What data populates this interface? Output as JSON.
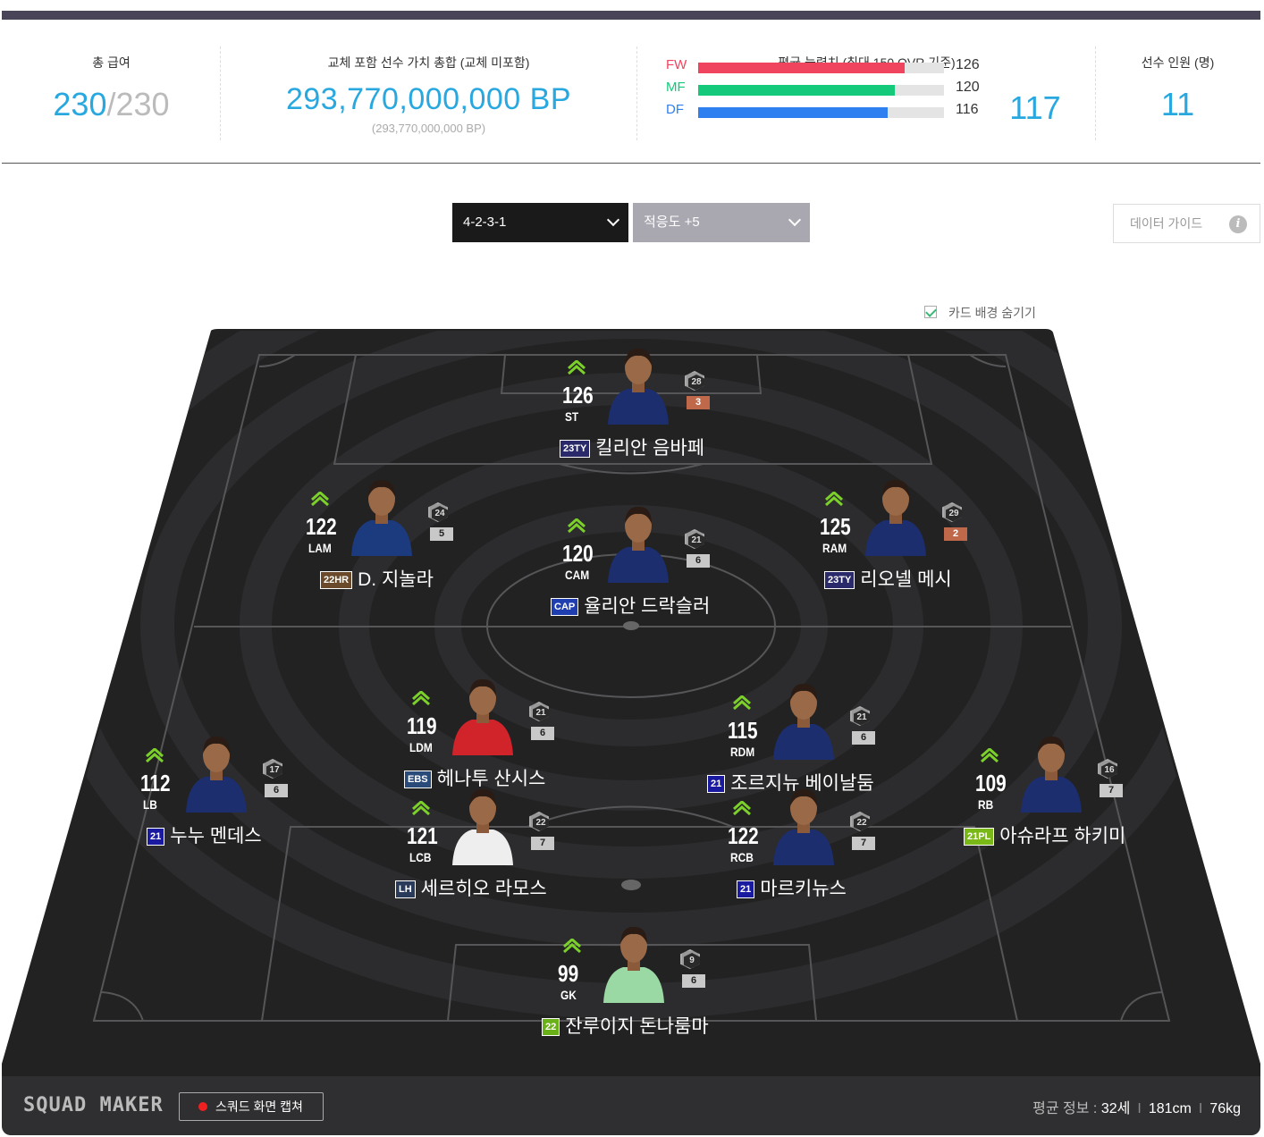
{
  "stats": {
    "salary_label": "총 급여",
    "salary_used": "230",
    "salary_sep": "/",
    "salary_max": "230",
    "bp_label": "교체 포함 선수 가치 총합 (교체 미포함)",
    "bp_value": "293,770,000,000 BP",
    "bp_sub": "(293,770,000,000 BP)",
    "ability_label": "평균 능력치 (최대 150 OVR 기준)",
    "abilities": [
      {
        "name": "FW",
        "value": "126",
        "color": "#f0445e",
        "fraction": 0.84
      },
      {
        "name": "MF",
        "value": "120",
        "color": "#14c97a",
        "fraction": 0.8
      },
      {
        "name": "DF",
        "value": "116",
        "color": "#2e7ff0",
        "fraction": 0.77
      }
    ],
    "ability_avg": "117",
    "count_label": "선수 인원 (명)",
    "count_value": "11"
  },
  "controls": {
    "formation": "4-2-3-1",
    "formation_bg": "#1a1a1a",
    "adaptability": "적응도 +5",
    "adaptability_bg": "#a9a7b0",
    "guide_label": "데이터 가이드",
    "guide_icon": "info-icon",
    "hide_bg_label": "카드 배경 숨기기"
  },
  "players": [
    {
      "id": "st",
      "ovr": "126",
      "pos": "ST",
      "name": "킬리안 음바페",
      "season": "23TY",
      "season_color": "#2a2a6a",
      "level": "28",
      "enh": "3",
      "enh_color": "#c0684a",
      "jersey": "#1c2e6e"
    },
    {
      "id": "lam",
      "ovr": "122",
      "pos": "LAM",
      "name": "D. 지놀라",
      "season": "22HR",
      "season_color": "#6a4a2a",
      "level": "24",
      "enh": "5",
      "enh_color": "#c8c8c8",
      "jersey": "#1c3a7e"
    },
    {
      "id": "cam",
      "ovr": "120",
      "pos": "CAM",
      "name": "율리안 드락슬러",
      "season": "CAP",
      "season_color": "#1f3fb0",
      "level": "21",
      "enh": "6",
      "enh_color": "#c8c8c8",
      "jersey": "#1c2e6e"
    },
    {
      "id": "ram",
      "ovr": "125",
      "pos": "RAM",
      "name": "리오넬 메시",
      "season": "23TY",
      "season_color": "#2a2a6a",
      "level": "29",
      "enh": "2",
      "enh_color": "#c0684a",
      "jersey": "#1c2e6e"
    },
    {
      "id": "ldm",
      "ovr": "119",
      "pos": "LDM",
      "name": "헤나투 산시스",
      "season": "EBS",
      "season_color": "#2a4a7a",
      "level": "21",
      "enh": "6",
      "enh_color": "#c8c8c8",
      "jersey": "#d0232a"
    },
    {
      "id": "rdm",
      "ovr": "115",
      "pos": "RDM",
      "name": "조르지뉴 베이날둠",
      "season": "21",
      "season_color": "#1a1aa0",
      "level": "21",
      "enh": "6",
      "enh_color": "#c8c8c8",
      "jersey": "#1c2e6e"
    },
    {
      "id": "lb",
      "ovr": "112",
      "pos": "LB",
      "name": "누누 멘데스",
      "season": "21",
      "season_color": "#1a1aa0",
      "level": "17",
      "enh": "6",
      "enh_color": "#c8c8c8",
      "jersey": "#1c2e6e"
    },
    {
      "id": "lcb",
      "ovr": "121",
      "pos": "LCB",
      "name": "세르히오 라모스",
      "season": "LH",
      "season_color": "#2a3a5a",
      "level": "22",
      "enh": "7",
      "enh_color": "#c8c8c8",
      "jersey": "#eeeeee"
    },
    {
      "id": "rcb",
      "ovr": "122",
      "pos": "RCB",
      "name": "마르키뉴스",
      "season": "21",
      "season_color": "#1a1aa0",
      "level": "22",
      "enh": "7",
      "enh_color": "#c8c8c8",
      "jersey": "#1c2e6e"
    },
    {
      "id": "rb",
      "ovr": "109",
      "pos": "RB",
      "name": "아슈라프 하키미",
      "season": "21PL",
      "season_color": "#7ab818",
      "level": "16",
      "enh": "7",
      "enh_color": "#c8c8c8",
      "jersey": "#1c2e6e"
    },
    {
      "id": "gk",
      "ovr": "99",
      "pos": "GK",
      "name": "잔루이지 돈나룸마",
      "season": "22",
      "season_color": "#6ab018",
      "level": "9",
      "enh": "6",
      "enh_color": "#c8c8c8",
      "jersey": "#9ad8a4"
    }
  ],
  "footer": {
    "logo": "SQUAD MAKER",
    "capture_label": "스쿼드 화면 캡쳐",
    "avg_label": "평균 정보 :",
    "avg_age": "32세",
    "avg_height": "181cm",
    "avg_weight": "76kg",
    "sep": "I"
  }
}
